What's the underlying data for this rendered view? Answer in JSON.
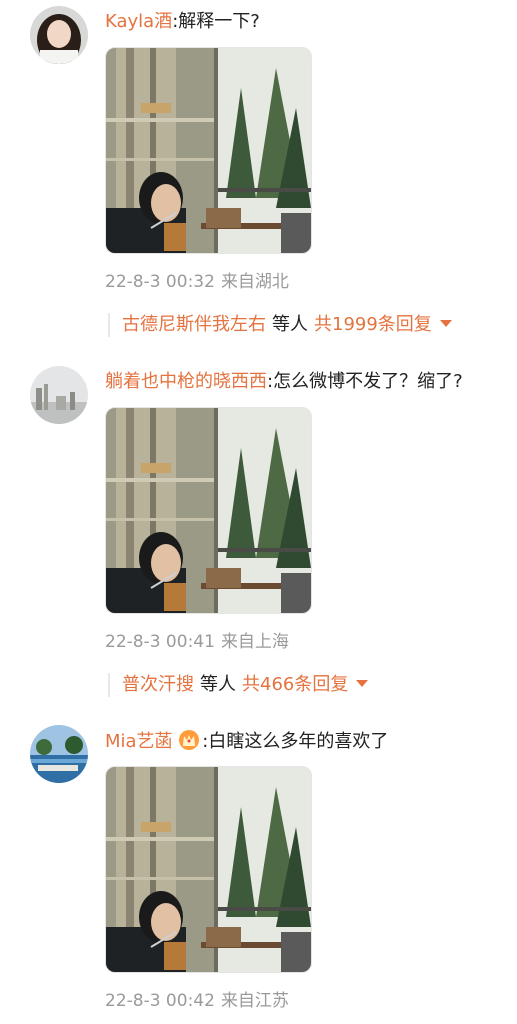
{
  "colors": {
    "accent": "#e5733f",
    "meta": "#9a9a9a",
    "text": "#222222"
  },
  "comments": [
    {
      "username": "Kayla酒",
      "separator": ":",
      "text": "解释一下?",
      "image_icon": "photo-thumbnail",
      "time": "22-8-3 00:32",
      "location": "来自湖北",
      "replies": {
        "names": "古德尼斯伴我左右",
        "middle": "等人",
        "count": "共1999条回复"
      }
    },
    {
      "username": "躺着也中枪的晓西西",
      "separator": ":",
      "text": "怎么微博不发了？缩了?",
      "image_icon": "photo-thumbnail",
      "time": "22-8-3 00:41",
      "location": "来自上海",
      "replies": {
        "names": "普次汗搜",
        "middle": "等人",
        "count": "共466条回复"
      }
    },
    {
      "username": "Mia艺菡",
      "badge_icon": "crown-icon",
      "separator": ":",
      "text": "白瞎这么多年的喜欢了",
      "image_icon": "photo-thumbnail",
      "time": "22-8-3 00:42",
      "location": "来自江苏"
    }
  ]
}
